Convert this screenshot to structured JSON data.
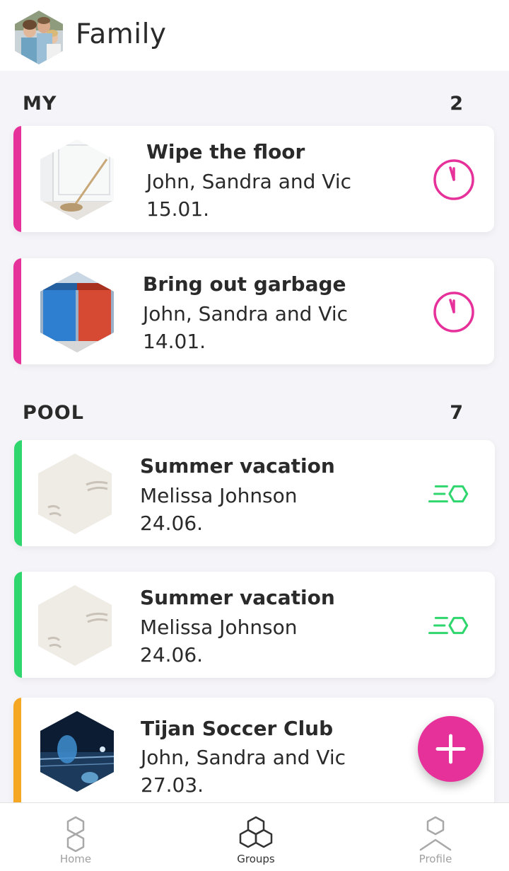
{
  "header": {
    "title": "Family"
  },
  "sections": {
    "my": {
      "label": "MY",
      "count": "2"
    },
    "pool": {
      "label": "POOL",
      "count": "7"
    }
  },
  "cards": [
    {
      "title": "Wipe the floor",
      "people": "John, Sandra and Vic",
      "date": "15.01.",
      "status_icon": "clock-icon",
      "color": "#e6309a"
    },
    {
      "title": "Bring out garbage",
      "people": "John, Sandra and Vic",
      "date": "14.01.",
      "status_icon": "clock-icon",
      "color": "#e6309a"
    },
    {
      "title": "Summer vacation",
      "people": "Melissa Johnson",
      "date": "24.06.",
      "status_icon": "fast-hexagon-icon",
      "color": "#2fd66e"
    },
    {
      "title": "Summer vacation",
      "people": "Melissa Johnson",
      "date": "24.06.",
      "status_icon": "fast-hexagon-icon",
      "color": "#2fd66e"
    },
    {
      "title": "Tijan Soccer Club",
      "people": "John, Sandra and Vic",
      "date": "27.03.",
      "status_icon": "none",
      "color": "#f5a623"
    }
  ],
  "nav": {
    "home": {
      "label": "Home",
      "icon": "home-hexagons-icon"
    },
    "groups": {
      "label": "Groups",
      "icon": "groups-hexagons-icon",
      "active": true
    },
    "profile": {
      "label": "Profile",
      "icon": "profile-icon"
    }
  },
  "fab": {
    "icon": "plus-icon",
    "color": "#e6309a"
  }
}
